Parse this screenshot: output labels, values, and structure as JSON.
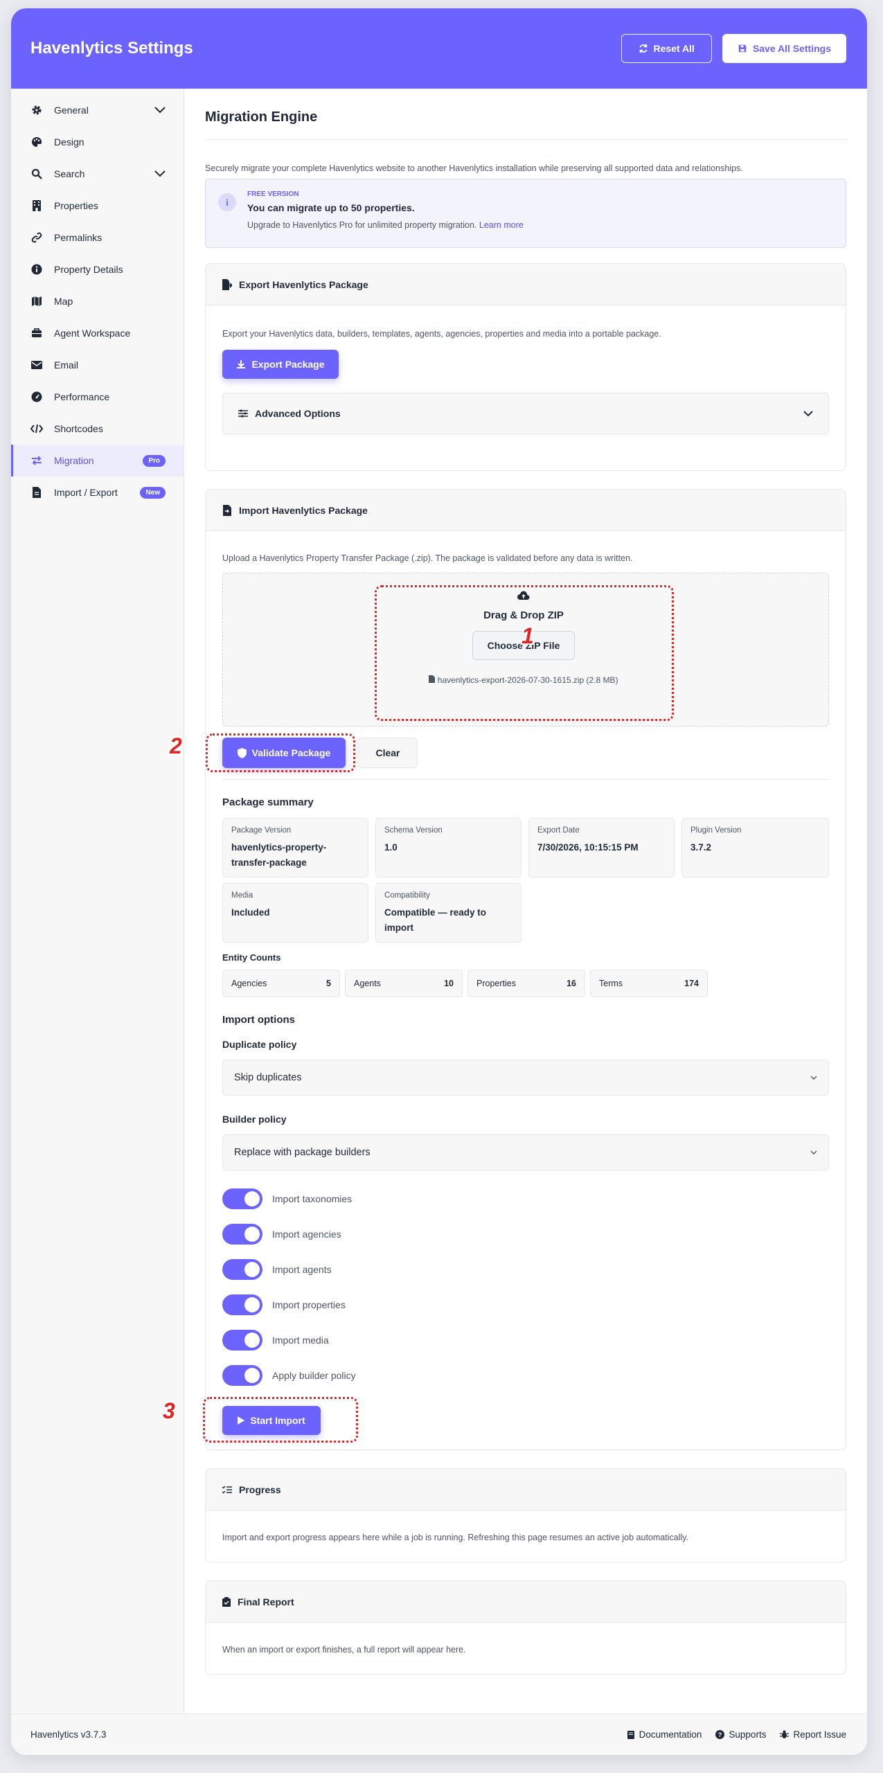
{
  "header": {
    "title": "Havenlytics Settings",
    "reset_label": "Reset All",
    "save_label": "Save All Settings"
  },
  "sidebar": {
    "items": [
      {
        "label": "General",
        "icon": "gear-icon",
        "chevron": true
      },
      {
        "label": "Design",
        "icon": "palette-icon"
      },
      {
        "label": "Search",
        "icon": "search-icon",
        "chevron": true
      },
      {
        "label": "Properties",
        "icon": "building-icon"
      },
      {
        "label": "Permalinks",
        "icon": "link-icon"
      },
      {
        "label": "Property Details",
        "icon": "info-icon"
      },
      {
        "label": "Map",
        "icon": "map-icon"
      },
      {
        "label": "Agent Workspace",
        "icon": "briefcase-icon"
      },
      {
        "label": "Email",
        "icon": "envelope-icon"
      },
      {
        "label": "Performance",
        "icon": "gauge-icon"
      },
      {
        "label": "Shortcodes",
        "icon": "code-icon"
      },
      {
        "label": "Migration",
        "icon": "arrows-swap-icon",
        "badge": "Pro",
        "active": true
      },
      {
        "label": "Import / Export",
        "icon": "file-icon",
        "badge": "New"
      }
    ]
  },
  "main": {
    "title": "Migration Engine",
    "description": "Securely migrate your complete Havenlytics website to another Havenlytics installation while preserving all supported data and relationships.",
    "notice": {
      "tag": "FREE VERSION",
      "head": "You can migrate up to 50 properties.",
      "sub": "Upgrade to Havenlytics Pro for unlimited property migration.",
      "link": "Learn more"
    },
    "export": {
      "title": "Export Havenlytics Package",
      "description": "Export your Havenlytics data, builders, templates, agents, agencies, properties and media into a portable package.",
      "button": "Export Package",
      "advanced": "Advanced Options"
    },
    "import": {
      "title": "Import Havenlytics Package",
      "description": "Upload a Havenlytics Property Transfer Package (.zip). The package is validated before any data is written.",
      "dropzone_title": "Drag & Drop ZIP",
      "choose_button": "Choose ZIP File",
      "file_name": "havenlytics-export-2026-07-30-1615.zip (2.8 MB)",
      "validate_button": "Validate Package",
      "clear_button": "Clear"
    },
    "summary": {
      "title": "Package summary",
      "fields": [
        {
          "label": "Package Version",
          "value": "havenlytics-property-transfer-package"
        },
        {
          "label": "Schema Version",
          "value": "1.0"
        },
        {
          "label": "Export Date",
          "value": "7/30/2026, 10:15:15 PM"
        },
        {
          "label": "Plugin Version",
          "value": "3.7.2"
        },
        {
          "label": "Media",
          "value": "Included"
        },
        {
          "label": "Compatibility",
          "value": "Compatible — ready to import"
        }
      ],
      "entity_title": "Entity Counts",
      "entities": [
        {
          "label": "Agencies",
          "value": "5"
        },
        {
          "label": "Agents",
          "value": "10"
        },
        {
          "label": "Properties",
          "value": "16"
        },
        {
          "label": "Terms",
          "value": "174"
        }
      ]
    },
    "options": {
      "title": "Import options",
      "duplicate_label": "Duplicate policy",
      "duplicate_value": "Skip duplicates",
      "builder_label": "Builder policy",
      "builder_value": "Replace with package builders",
      "toggles": [
        {
          "label": "Import taxonomies",
          "on": true
        },
        {
          "label": "Import agencies",
          "on": true
        },
        {
          "label": "Import agents",
          "on": true
        },
        {
          "label": "Import properties",
          "on": true
        },
        {
          "label": "Import media",
          "on": true
        },
        {
          "label": "Apply builder policy",
          "on": true
        }
      ],
      "start_button": "Start Import"
    },
    "progress": {
      "title": "Progress",
      "text": "Import and export progress appears here while a job is running. Refreshing this page resumes an active job automatically."
    },
    "report": {
      "title": "Final Report",
      "text": "When an import or export finishes, a full report will appear here."
    }
  },
  "annotations": {
    "marker_1": "1",
    "marker_2": "2",
    "marker_3": "3",
    "color": "#d42a2a"
  },
  "footer": {
    "version": "Havenlytics v3.7.3",
    "links": [
      "Documentation",
      "Supports",
      "Report Issue"
    ]
  },
  "colors": {
    "accent": "#6c63ff",
    "background": "#e9ebf0"
  }
}
